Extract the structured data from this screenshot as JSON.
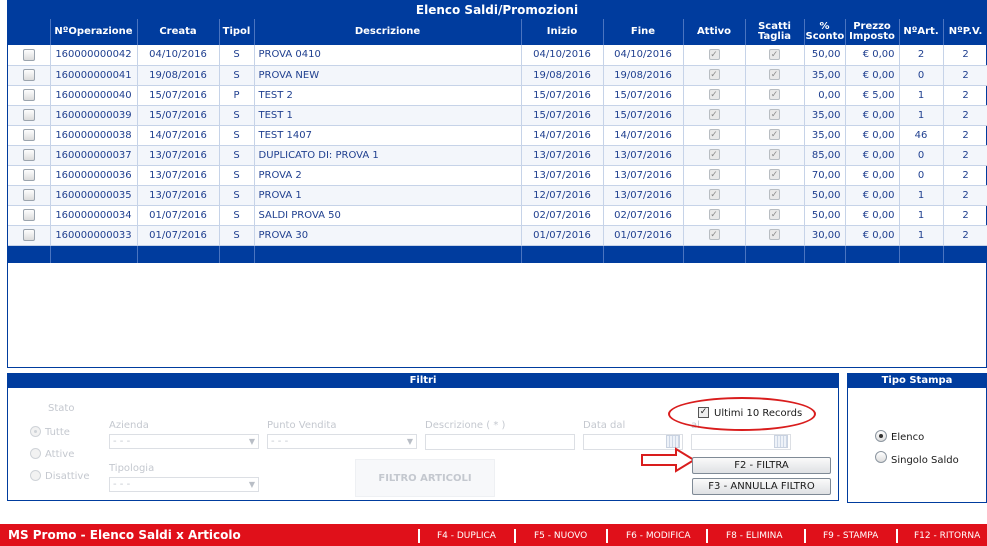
{
  "grid": {
    "title": "Elenco Saldi/Promozioni",
    "columns": [
      "NºOperazione",
      "Creata",
      "Tipol",
      "Descrizione",
      "Inizio",
      "Fine",
      "Attivo",
      "Scatti Taglia",
      "% Sconto",
      "Prezzo Imposto",
      "NºArt.",
      "NºP.V."
    ],
    "rows": [
      {
        "num": "160000000042",
        "creata": "04/10/2016",
        "tipol": "S",
        "desc": "PROVA 0410",
        "inizio": "04/10/2016",
        "fine": "04/10/2016",
        "sconto": "50,00",
        "prezzo": "€ 0,00",
        "nart": "2",
        "npv": "2"
      },
      {
        "num": "160000000041",
        "creata": "19/08/2016",
        "tipol": "S",
        "desc": "PROVA NEW",
        "inizio": "19/08/2016",
        "fine": "19/08/2016",
        "sconto": "35,00",
        "prezzo": "€ 0,00",
        "nart": "0",
        "npv": "2"
      },
      {
        "num": "160000000040",
        "creata": "15/07/2016",
        "tipol": "P",
        "desc": "TEST 2",
        "inizio": "15/07/2016",
        "fine": "15/07/2016",
        "sconto": "0,00",
        "prezzo": "€ 5,00",
        "nart": "1",
        "npv": "2"
      },
      {
        "num": "160000000039",
        "creata": "15/07/2016",
        "tipol": "S",
        "desc": "TEST 1",
        "inizio": "15/07/2016",
        "fine": "15/07/2016",
        "sconto": "35,00",
        "prezzo": "€ 0,00",
        "nart": "1",
        "npv": "2"
      },
      {
        "num": "160000000038",
        "creata": "14/07/2016",
        "tipol": "S",
        "desc": "TEST 1407",
        "inizio": "14/07/2016",
        "fine": "14/07/2016",
        "sconto": "35,00",
        "prezzo": "€ 0,00",
        "nart": "46",
        "npv": "2"
      },
      {
        "num": "160000000037",
        "creata": "13/07/2016",
        "tipol": "S",
        "desc": "DUPLICATO DI: PROVA 1",
        "inizio": "13/07/2016",
        "fine": "13/07/2016",
        "sconto": "85,00",
        "prezzo": "€ 0,00",
        "nart": "0",
        "npv": "2"
      },
      {
        "num": "160000000036",
        "creata": "13/07/2016",
        "tipol": "S",
        "desc": "PROVA 2",
        "inizio": "13/07/2016",
        "fine": "13/07/2016",
        "sconto": "70,00",
        "prezzo": "€ 0,00",
        "nart": "0",
        "npv": "2"
      },
      {
        "num": "160000000035",
        "creata": "13/07/2016",
        "tipol": "S",
        "desc": "PROVA 1",
        "inizio": "12/07/2016",
        "fine": "13/07/2016",
        "sconto": "50,00",
        "prezzo": "€ 0,00",
        "nart": "1",
        "npv": "2"
      },
      {
        "num": "160000000034",
        "creata": "01/07/2016",
        "tipol": "S",
        "desc": "SALDI PROVA 50",
        "inizio": "02/07/2016",
        "fine": "02/07/2016",
        "sconto": "50,00",
        "prezzo": "€ 0,00",
        "nart": "1",
        "npv": "2"
      },
      {
        "num": "160000000033",
        "creata": "01/07/2016",
        "tipol": "S",
        "desc": "PROVA 30",
        "inizio": "01/07/2016",
        "fine": "01/07/2016",
        "sconto": "30,00",
        "prezzo": "€ 0,00",
        "nart": "1",
        "npv": "2"
      }
    ]
  },
  "filtri": {
    "title": "Filtri",
    "stato_label": "Stato",
    "stato_tutte": "Tutte",
    "stato_attive": "Attive",
    "stato_disattive": "Disattive",
    "azienda_label": "Azienda",
    "azienda_value": "- - -",
    "pv_label": "Punto Vendita",
    "pv_value": "- - -",
    "descrizione_label": "Descrizione ( * )",
    "data_dal_label": "Data dal",
    "data_al_label": "al",
    "tipologia_label": "Tipologia",
    "tipologia_value": "- - -",
    "filtro_articoli": "FILTRO ARTICOLI",
    "ultimi_label": "Ultimi 10 Records",
    "btn_filtra": "F2 - FILTRA",
    "btn_annulla": "F3 - ANNULLA FILTRO"
  },
  "tipo_stampa": {
    "title": "Tipo Stampa",
    "elenco": "Elenco",
    "singolo": "Singolo Saldo"
  },
  "status_bar": {
    "title": "MS Promo - Elenco Saldi x Articolo",
    "f4": "F4 - DUPLICA",
    "f5": "F5 - NUOVO",
    "f6": "F6 - MODIFICA",
    "f8": "F8 - ELIMINA",
    "f9": "F9 - STAMPA",
    "f12": "F12 - RITORNA"
  },
  "colors": {
    "header_blue": "#003c9e",
    "status_red": "#e0101a",
    "annotation_red": "#d91d1d"
  }
}
